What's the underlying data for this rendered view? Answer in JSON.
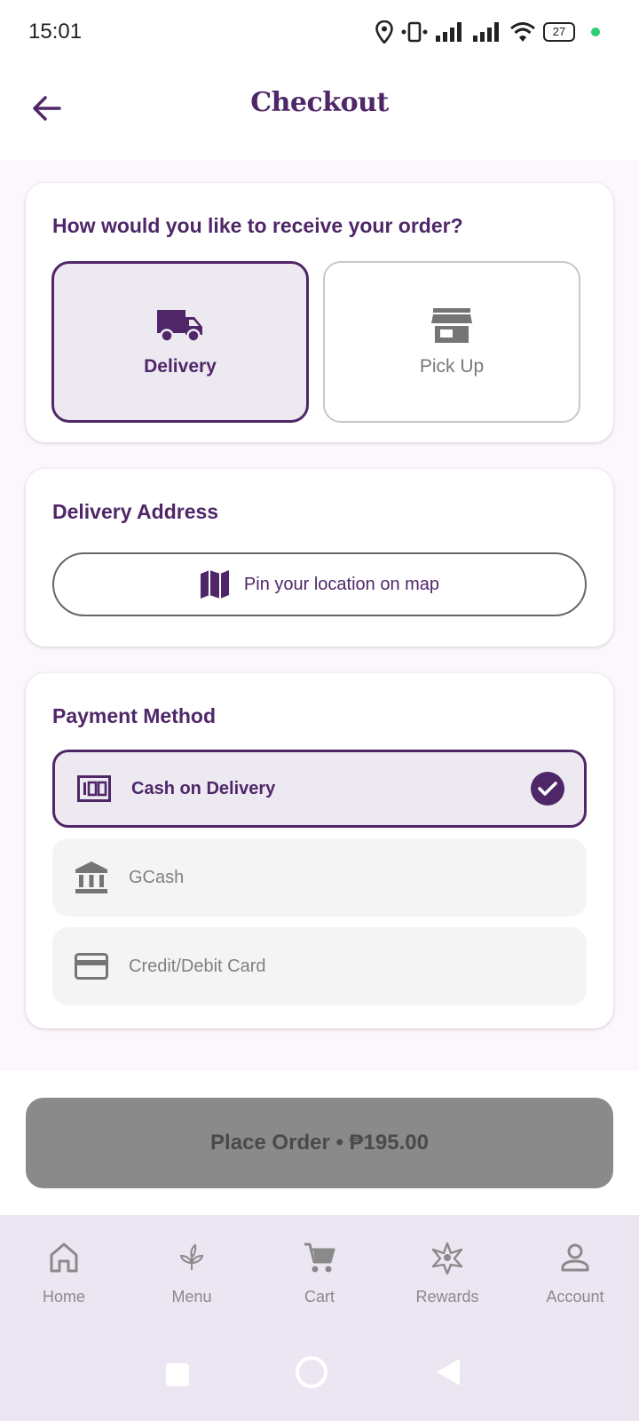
{
  "status_bar": {
    "time": "15:01",
    "battery": "27",
    "icons": [
      "location-icon",
      "vibrate-icon",
      "signal-icon",
      "signal-icon",
      "wifi-icon",
      "battery-icon"
    ],
    "dot_color": "#2ecc71"
  },
  "header": {
    "title": "Checkout",
    "back_icon": "arrow-left-icon"
  },
  "receive_card": {
    "title": "How would you like to receive your order?",
    "options": [
      {
        "label": "Delivery",
        "icon": "truck-icon",
        "selected": true
      },
      {
        "label": "Pick Up",
        "icon": "store-icon",
        "selected": false
      }
    ]
  },
  "address_card": {
    "title": "Delivery Address",
    "pin_button_label": "Pin your location on map",
    "pin_icon": "map-icon"
  },
  "payment_card": {
    "title": "Payment Method",
    "methods": [
      {
        "label": "Cash on Delivery",
        "icon": "cash-icon",
        "selected": true
      },
      {
        "label": "GCash",
        "icon": "bank-icon",
        "selected": false
      },
      {
        "label": "Credit/Debit Card",
        "icon": "card-icon",
        "selected": false
      }
    ]
  },
  "place_order": {
    "label": "Place Order • ₱195.00"
  },
  "bottom_nav": {
    "items": [
      {
        "label": "Home",
        "icon": "home-icon"
      },
      {
        "label": "Menu",
        "icon": "leaf-icon"
      },
      {
        "label": "Cart",
        "icon": "cart-icon"
      },
      {
        "label": "Rewards",
        "icon": "rewards-icon"
      },
      {
        "label": "Account",
        "icon": "account-icon"
      }
    ]
  },
  "colors": {
    "brand": "#4f2769",
    "content_bg": "#fcf6fd",
    "selected_bg": "#ede9f0",
    "disabled_button": "#8a8a8a",
    "nav_bg": "#ece6f3"
  }
}
